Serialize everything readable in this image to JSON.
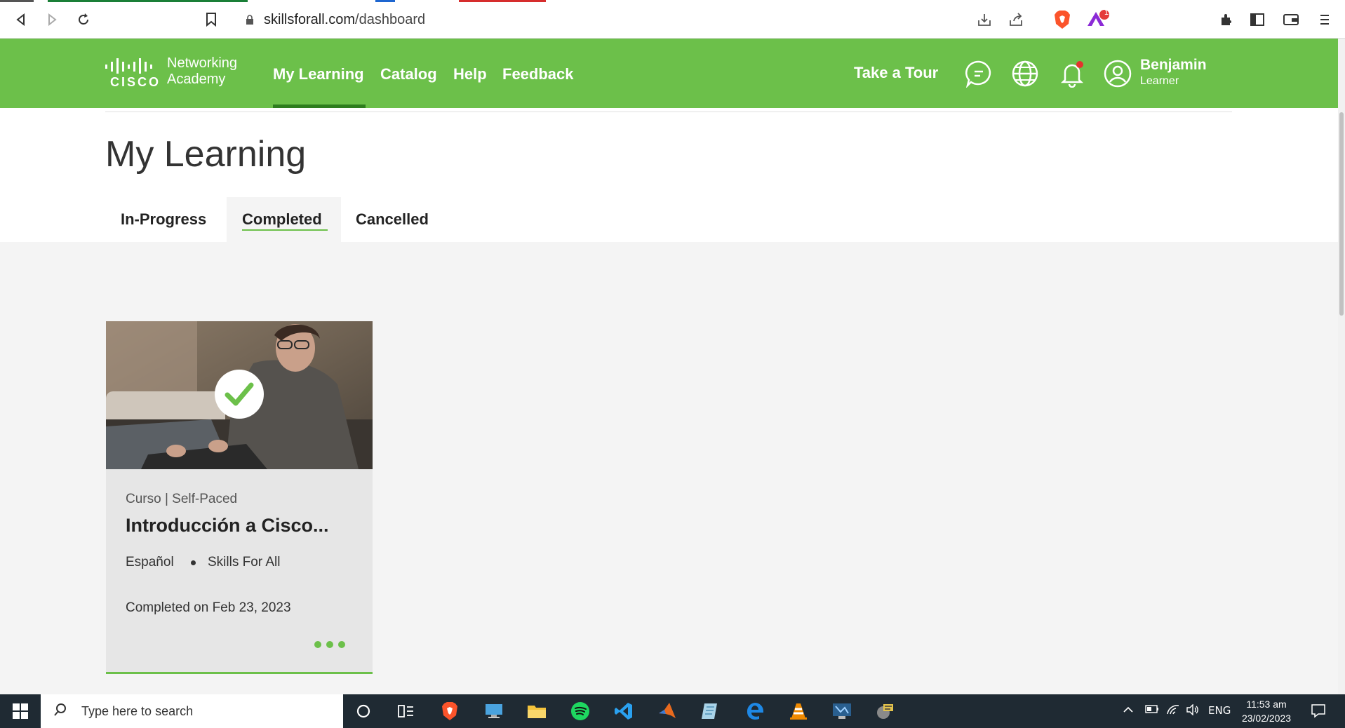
{
  "browser": {
    "url_host": "skillsforall.com",
    "url_path": "/dashboard",
    "brave_badge": "1"
  },
  "header": {
    "logo_brand": "CISCO",
    "logo_line1": "Networking",
    "logo_line2": "Academy",
    "nav": [
      "My Learning",
      "Catalog",
      "Help",
      "Feedback"
    ],
    "take_tour": "Take a Tour",
    "user_name": "Benjamin",
    "user_role": "Learner"
  },
  "page": {
    "title": "My Learning",
    "tabs": [
      "In-Progress",
      "Completed",
      "Cancelled"
    ],
    "active_tab": "Completed"
  },
  "card": {
    "meta": "Curso | Self-Paced",
    "title": "Introducción a Cisco...",
    "language": "Español",
    "organization": "Skills For All",
    "completed": "Completed on Feb 23, 2023"
  },
  "taskbar": {
    "search_placeholder": "Type here to search",
    "language": "ENG",
    "time": "11:53 am",
    "date": "23/02/2023"
  },
  "colors": {
    "brand_green": "#6cc04a",
    "nav_underline": "#2e7d1e",
    "taskbar": "#1f2a33"
  }
}
